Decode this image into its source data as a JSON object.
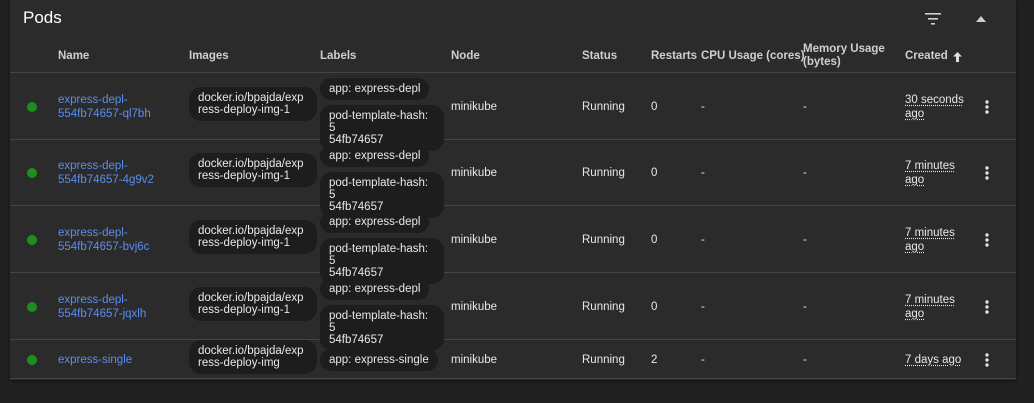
{
  "card": {
    "title": "Pods"
  },
  "columns": {
    "name": "Name",
    "images": "Images",
    "labels": "Labels",
    "node": "Node",
    "status": "Status",
    "restarts": "Restarts",
    "cpu": "CPU Usage (cores)",
    "memory_l1": "Memory Usage",
    "memory_l2": "(bytes)",
    "created": "Created"
  },
  "status_color": "#1e8e1e",
  "link_color": "#5b8def",
  "rows": [
    {
      "name_l1": "express-depl-",
      "name_l2": "554fb74657-ql7bh",
      "image_l1": "docker.io/bpajda/exp",
      "image_l2": "ress-deploy-img-1",
      "label1": "app: express-depl",
      "label2_l1": "pod-template-hash: 5",
      "label2_l2": "54fb74657",
      "node": "minikube",
      "status": "Running",
      "restarts": "0",
      "cpu": "-",
      "memory": "-",
      "created_l1": "30 seconds",
      "created_l2": "ago"
    },
    {
      "name_l1": "express-depl-",
      "name_l2": "554fb74657-4g9v2",
      "image_l1": "docker.io/bpajda/exp",
      "image_l2": "ress-deploy-img-1",
      "label1": "app: express-depl",
      "label2_l1": "pod-template-hash: 5",
      "label2_l2": "54fb74657",
      "node": "minikube",
      "status": "Running",
      "restarts": "0",
      "cpu": "-",
      "memory": "-",
      "created_l1": "7 minutes",
      "created_l2": "ago"
    },
    {
      "name_l1": "express-depl-",
      "name_l2": "554fb74657-bvj6c",
      "image_l1": "docker.io/bpajda/exp",
      "image_l2": "ress-deploy-img-1",
      "label1": "app: express-depl",
      "label2_l1": "pod-template-hash: 5",
      "label2_l2": "54fb74657",
      "node": "minikube",
      "status": "Running",
      "restarts": "0",
      "cpu": "-",
      "memory": "-",
      "created_l1": "7 minutes",
      "created_l2": "ago"
    },
    {
      "name_l1": "express-depl-",
      "name_l2": "554fb74657-jqxlh",
      "image_l1": "docker.io/bpajda/exp",
      "image_l2": "ress-deploy-img-1",
      "label1": "app: express-depl",
      "label2_l1": "pod-template-hash: 5",
      "label2_l2": "54fb74657",
      "node": "minikube",
      "status": "Running",
      "restarts": "0",
      "cpu": "-",
      "memory": "-",
      "created_l1": "7 minutes",
      "created_l2": "ago"
    },
    {
      "name_l1": "express-single",
      "image_l1": "docker.io/bpajda/exp",
      "image_l2": "ress-deploy-img",
      "label1": "app: express-single",
      "node": "minikube",
      "status": "Running",
      "restarts": "2",
      "cpu": "-",
      "memory": "-",
      "created_l1": "7 days ago"
    }
  ]
}
